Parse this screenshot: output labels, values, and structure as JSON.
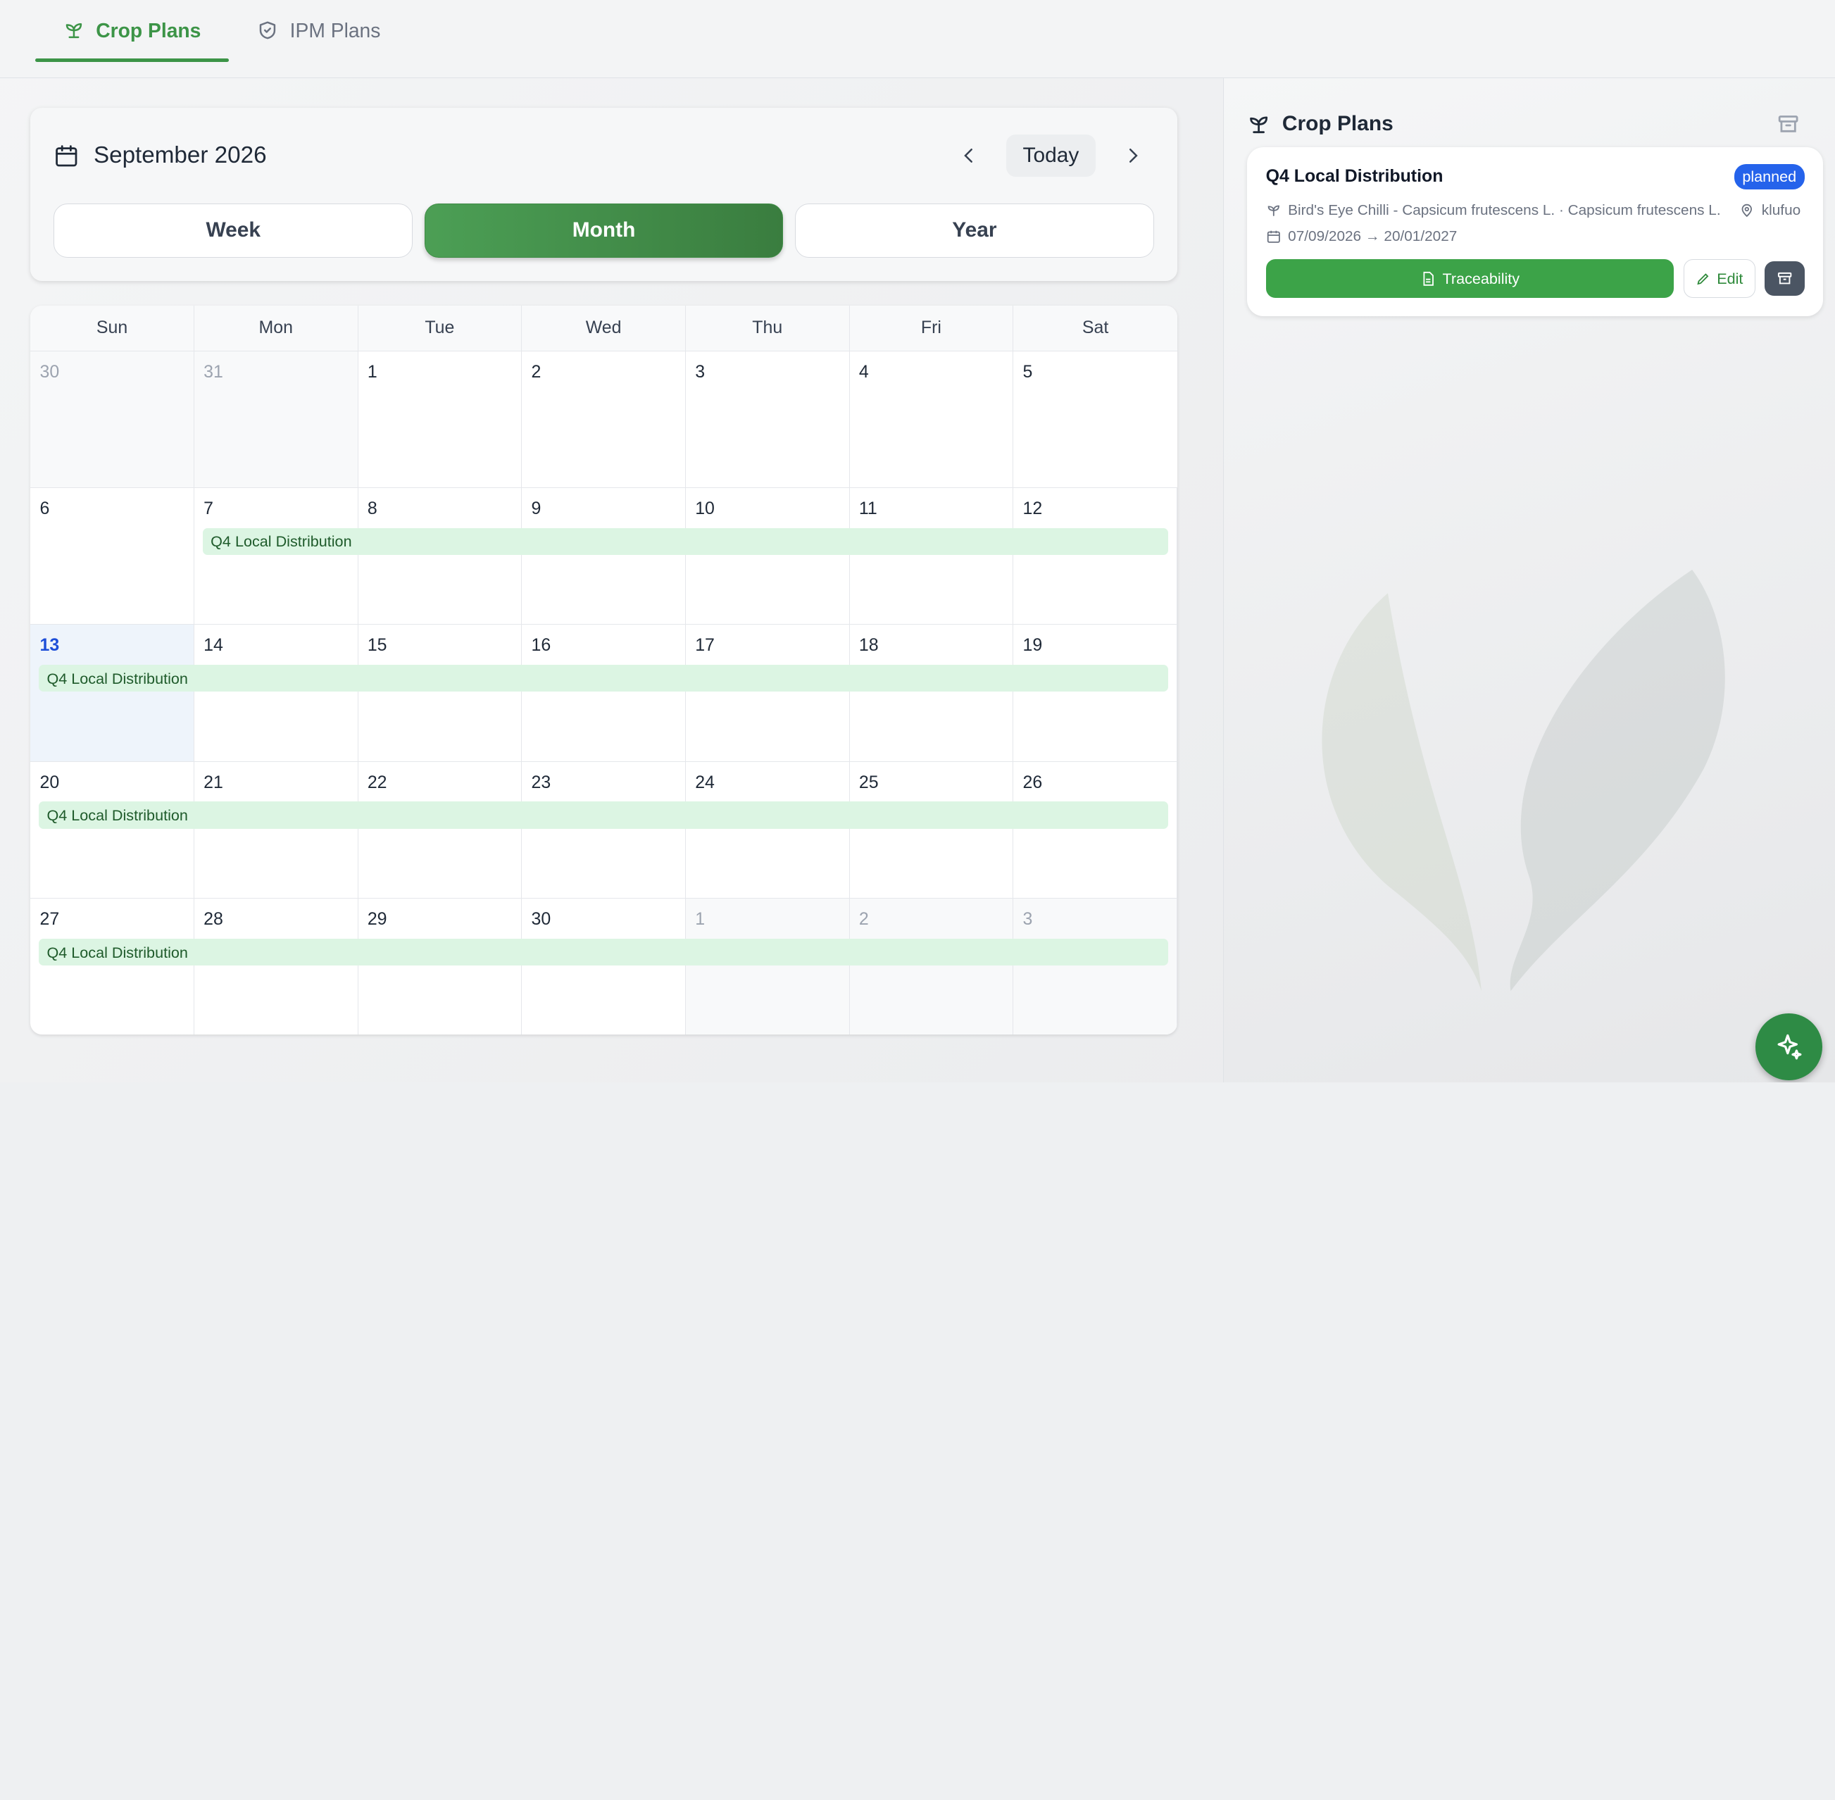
{
  "tabs": [
    {
      "label": "Crop Plans",
      "icon": "sprout-icon",
      "active": true
    },
    {
      "label": "IPM Plans",
      "icon": "shield-check-icon",
      "active": false
    }
  ],
  "calendar": {
    "month_label": "September 2026",
    "today_label": "Today",
    "views": [
      "Week",
      "Month",
      "Year"
    ],
    "active_view": "Month",
    "weekdays": [
      "Sun",
      "Mon",
      "Tue",
      "Wed",
      "Thu",
      "Fri",
      "Sat"
    ],
    "weeks": [
      [
        "30",
        "31",
        "1",
        "2",
        "3",
        "4",
        "5"
      ],
      [
        "6",
        "7",
        "8",
        "9",
        "10",
        "11",
        "12"
      ],
      [
        "13",
        "14",
        "15",
        "16",
        "17",
        "18",
        "19"
      ],
      [
        "20",
        "21",
        "22",
        "23",
        "24",
        "25",
        "26"
      ],
      [
        "27",
        "28",
        "29",
        "30",
        "1",
        "2",
        "3"
      ]
    ],
    "event_label": "Q4 Local Distribution"
  },
  "panel": {
    "title": "Crop Plans",
    "plan": {
      "title": "Q4 Local Distribution",
      "status": "planned",
      "crop": "Bird's Eye Chilli - Capsicum frutescens L. · Capsicum frutescens L.",
      "location": "klufuo",
      "dates": "07/09/2026 → 20/01/2027",
      "traceability_label": "Traceability",
      "edit_label": "Edit"
    }
  },
  "colors": {
    "accent": "#3c9447",
    "status_planned": "#2563eb",
    "today_highlight": "#eef4fb",
    "event_bg": "#dcf5e3"
  }
}
